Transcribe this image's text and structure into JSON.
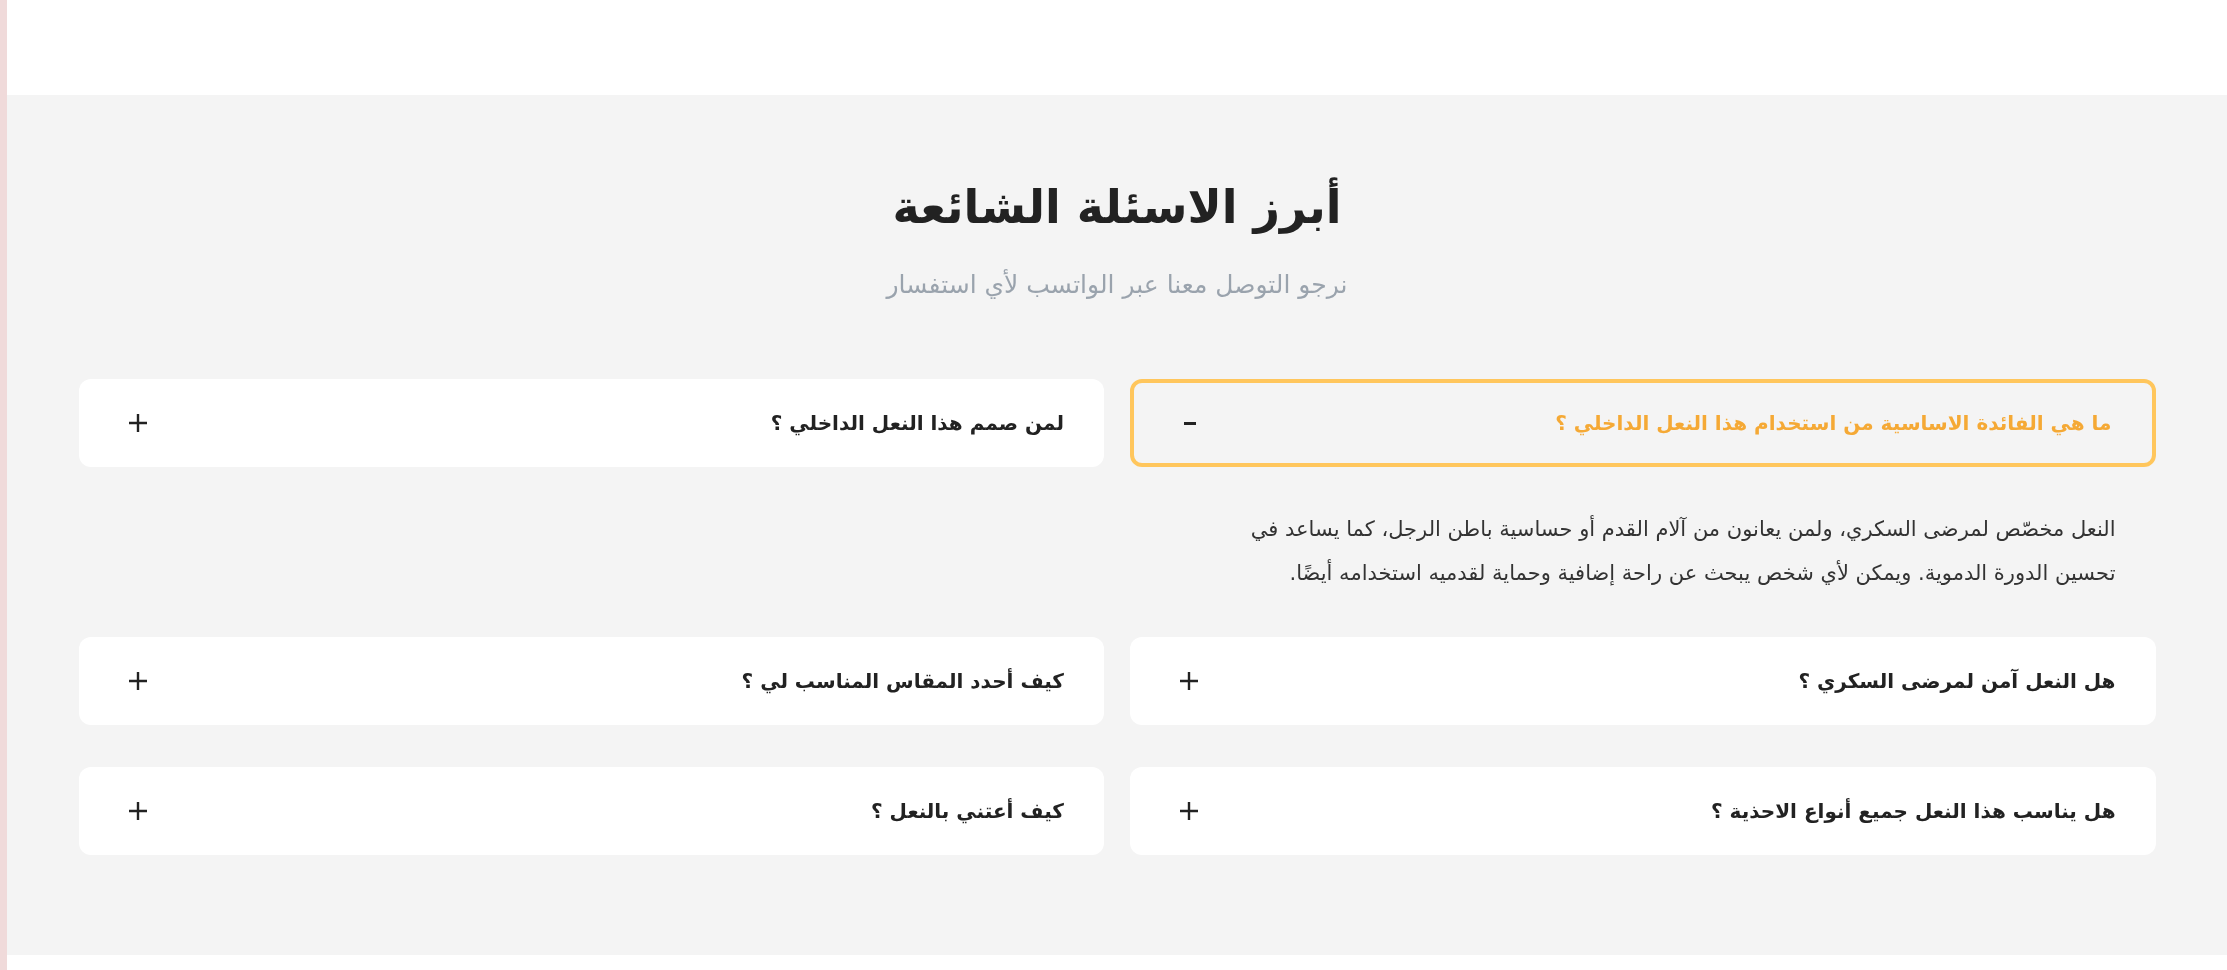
{
  "title": "أبرز الاسئلة الشائعة",
  "subtitle": "نرجو التوصل معنا عبر الواتسب لأي استفسار",
  "faq": [
    {
      "question": "ما هي الفائدة الاساسية من استخدام هذا النعل الداخلي ؟",
      "expanded": true,
      "answer": "النعل مخصّص لمرضى السكري، ولمن يعانون من آلام القدم أو حساسية باطن الرجل، كما يساعد في تحسين الدورة الدموية. ويمكن لأي شخص يبحث عن راحة إضافية وحماية لقدميه استخدامه أيضًا."
    },
    {
      "question": "لمن صمم هذا النعل الداخلي ؟",
      "expanded": false
    },
    {
      "question": "هل النعل آمن لمرضى السكري ؟",
      "expanded": false
    },
    {
      "question": "كيف أحدد المقاس المناسب لي ؟",
      "expanded": false
    },
    {
      "question": "هل يناسب هذا النعل جميع أنواع الاحذية ؟",
      "expanded": false
    },
    {
      "question": "كيف أعتني بالنعل ؟",
      "expanded": false
    }
  ]
}
